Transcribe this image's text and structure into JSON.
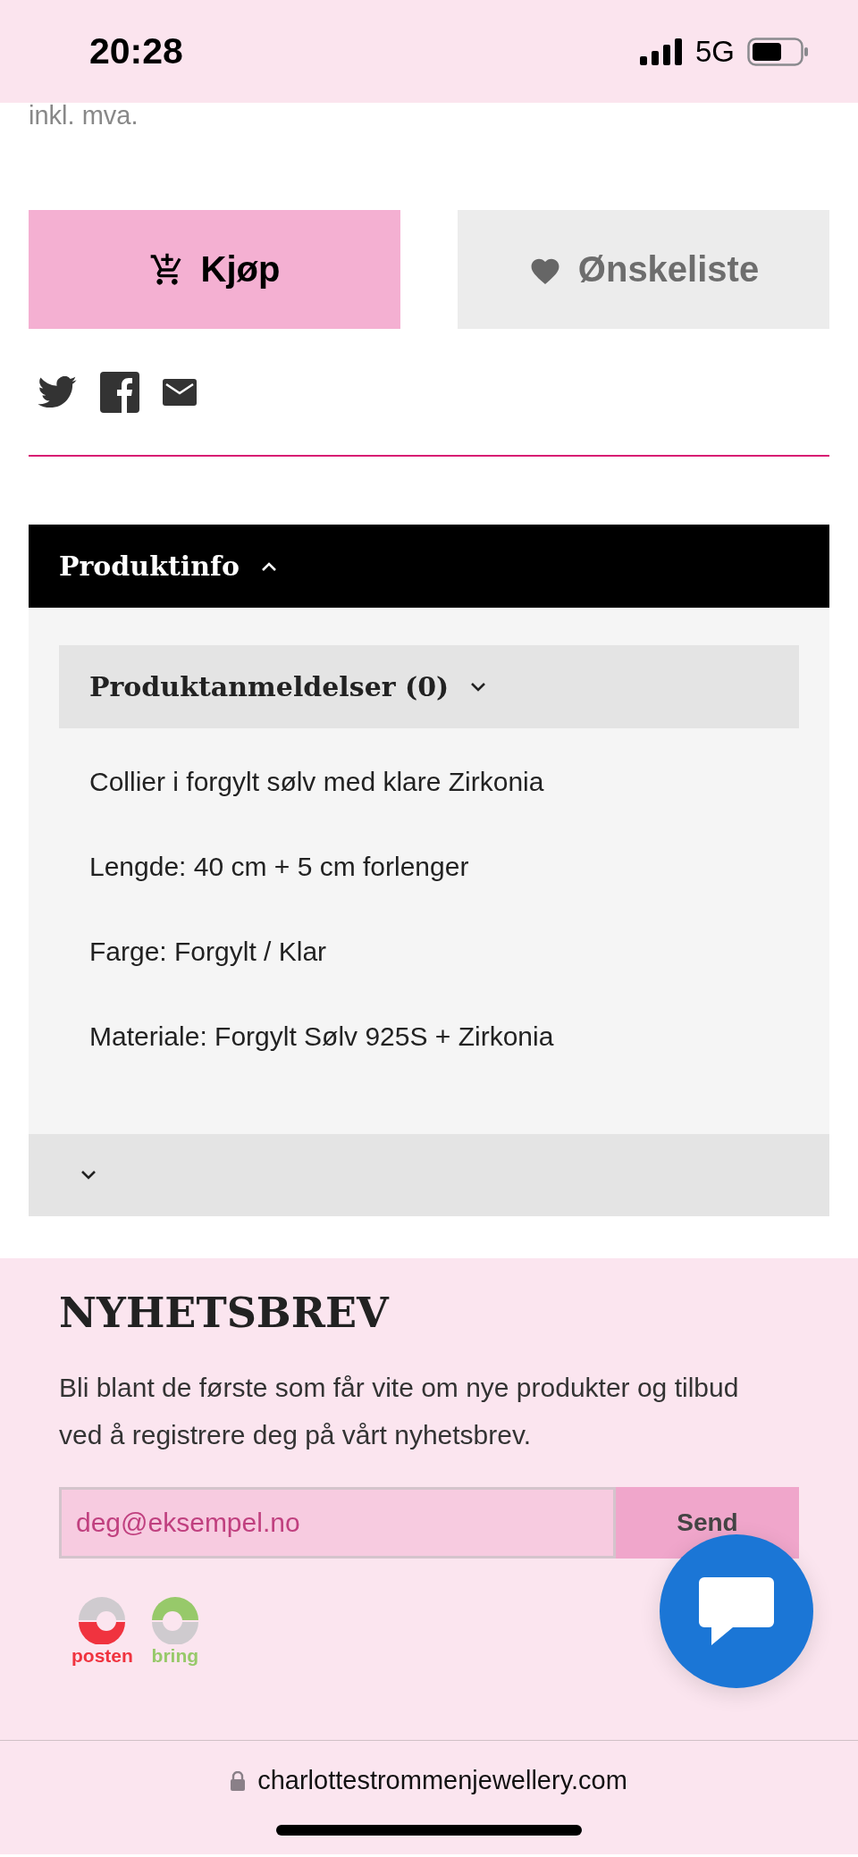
{
  "status_bar": {
    "time": "20:28",
    "network": "5G"
  },
  "price_note": "inkl. mva.",
  "buttons": [
    {
      "kind": "buy",
      "label": "Kjøp"
    },
    {
      "kind": "wishlist",
      "label": "Ønskeliste"
    }
  ],
  "share_icons": [
    {
      "kind": "twitter"
    },
    {
      "kind": "facebook"
    },
    {
      "kind": "email"
    }
  ],
  "accordion": {
    "title": "Produktinfo",
    "expanded": true,
    "subsection": {
      "title": "Produktanmeldelser (0)",
      "expanded": false
    },
    "lines": [
      "Collier i forgylt sølv med klare Zirkonia",
      "Lengde: 40 cm + 5 cm forlenger",
      "Farge: Forgylt / Klar",
      "Materiale: Forgylt Sølv 925S + Zirkonia"
    ],
    "footer_bar": {
      "expanded": false
    }
  },
  "newsletter": {
    "title": "NYHETSBREV",
    "text": "Bli blant de første som får vite om nye produkter og tilbud ved å registrere deg på vårt nyhetsbrev.",
    "placeholder": "deg@eksempel.no",
    "button": "Send"
  },
  "shipping_logos": [
    {
      "label": "posten",
      "color": "#f0333f"
    },
    {
      "label": "bring",
      "color": "#97c96a"
    }
  ],
  "browser": {
    "url": "charlottestrommenjewellery.com"
  }
}
